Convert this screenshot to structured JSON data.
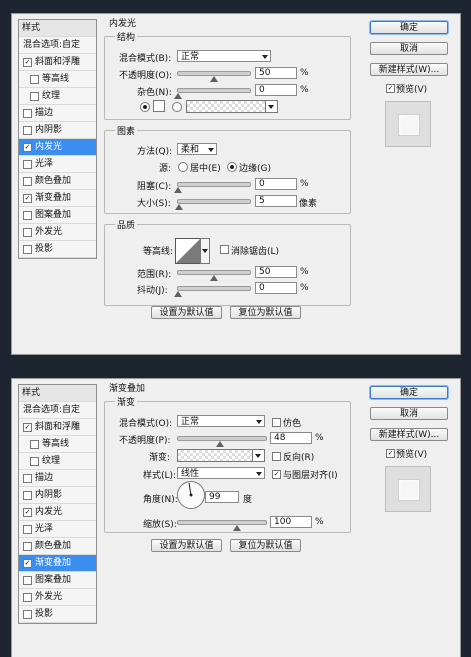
{
  "styles_header": "样式",
  "blend_options": "混合选项:自定",
  "style_items": [
    {
      "label": "斜面和浮雕",
      "checked": true
    },
    {
      "label": "等高线",
      "checked": false
    },
    {
      "label": "纹理",
      "checked": false
    },
    {
      "label": "描边",
      "checked": false
    },
    {
      "label": "内阴影",
      "checked": false
    },
    {
      "label": "内发光",
      "checked": true
    },
    {
      "label": "光泽",
      "checked": false
    },
    {
      "label": "颜色叠加",
      "checked": false
    },
    {
      "label": "渐变叠加",
      "checked": true
    },
    {
      "label": "图案叠加",
      "checked": false
    },
    {
      "label": "外发光",
      "checked": false
    },
    {
      "label": "投影",
      "checked": false
    }
  ],
  "check_mark": "✓",
  "buttons": {
    "ok": "确定",
    "cancel": "取消",
    "new_style": "新建样式(W)...",
    "preview": "预览(V)",
    "set_default": "设置为默认值",
    "reset_default": "复位为默认值"
  },
  "inner_glow": {
    "title": "内发光",
    "structure_title": "结构",
    "blend_mode_label": "混合模式(B):",
    "blend_mode_value": "正常",
    "opacity_label": "不透明度(O):",
    "opacity_value": "50",
    "opacity_level": 50,
    "noise_label": "杂色(N):",
    "noise_value": "0",
    "noise_level": 0,
    "elements_title": "图素",
    "technique_label": "方法(Q):",
    "technique_value": "柔和",
    "source_label": "源:",
    "source_center": "居中(E)",
    "source_edge": "边缘(G)",
    "choke_label": "阻塞(C):",
    "choke_value": "0",
    "choke_level": 0,
    "size_label": "大小(S):",
    "size_value": "5",
    "size_level": 2,
    "size_unit": "像素",
    "quality_title": "品质",
    "contour_label": "等高线:",
    "anti_alias_label": "消除锯齿(L)",
    "range_label": "范围(R):",
    "range_value": "50",
    "range_level": 50,
    "jitter_label": "抖动(J):",
    "jitter_value": "0",
    "jitter_level": 0,
    "percent": "%"
  },
  "gradient_overlay": {
    "title": "渐变叠加",
    "group_title": "渐变",
    "blend_mode_label": "混合模式(O):",
    "blend_mode_value": "正常",
    "dither_label": "仿色",
    "opacity_label": "不透明度(P):",
    "opacity_value": "48",
    "opacity_level": 48,
    "gradient_label": "渐变:",
    "reverse_label": "反向(R)",
    "style_label": "样式(L):",
    "style_value": "线性",
    "align_label": "与图层对齐(I)",
    "angle_label": "角度(N):",
    "angle_value": "99",
    "angle_unit": "度",
    "scale_label": "缩放(S):",
    "scale_value": "100",
    "scale_level": 100,
    "percent": "%"
  }
}
